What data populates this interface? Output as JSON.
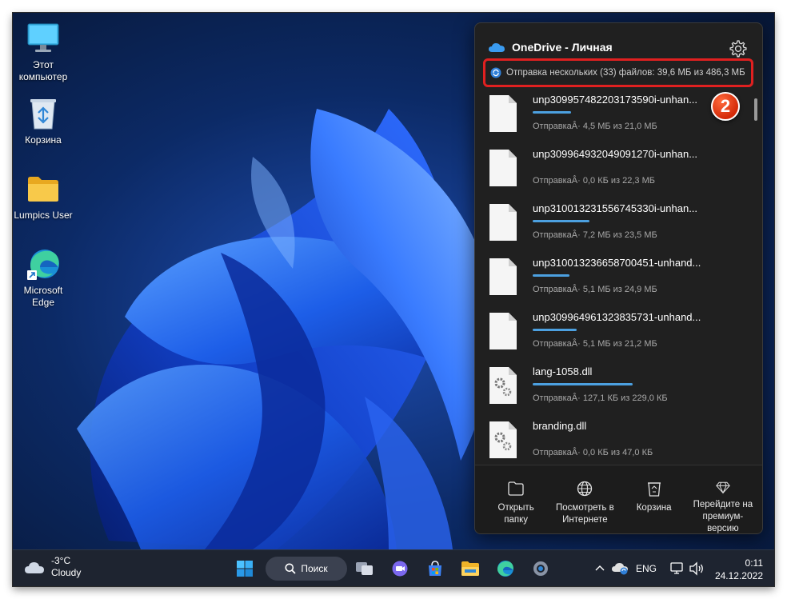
{
  "desktop": {
    "icons": [
      {
        "label_line1": "Этот",
        "label_line2": "компьютер",
        "icon": "monitor-icon"
      },
      {
        "label_line1": "Корзина",
        "label_line2": "",
        "icon": "recycle-bin-icon"
      },
      {
        "label_line1": "Lumpics User",
        "label_line2": "",
        "icon": "folder-icon"
      },
      {
        "label_line1": "Microsoft",
        "label_line2": "Edge",
        "icon": "edge-icon"
      }
    ]
  },
  "onedrive": {
    "title": "OneDrive - Личная",
    "status": "Отправка нескольких (33) файлов: 39,6 МБ из 486,3 МБ",
    "step_badge": "2",
    "accent_color": "#4ca0e0",
    "highlight_color": "#e02020",
    "files": [
      {
        "name": "unp309957482203173590i-unhan...",
        "status": "ОтправкаÂ· 4,5 МБ из 21,0 МБ",
        "progress": 0.21,
        "type": "document"
      },
      {
        "name": "unp309964932049091270i-unhan...",
        "status": "ОтправкаÂ· 0,0 КБ из 22,3 МБ",
        "progress": 0.0,
        "type": "document"
      },
      {
        "name": "unp310013231556745330i-unhan...",
        "status": "ОтправкаÂ· 7,2 МБ из 23,5 МБ",
        "progress": 0.31,
        "type": "document"
      },
      {
        "name": "unp310013236658700451-unhand...",
        "status": "ОтправкаÂ· 5,1 МБ из 24,9 МБ",
        "progress": 0.2,
        "type": "document"
      },
      {
        "name": "unp309964961323835731-unhand...",
        "status": "ОтправкаÂ· 5,1 МБ из 21,2 МБ",
        "progress": 0.24,
        "type": "document"
      },
      {
        "name": "lang-1058.dll",
        "status": "ОтправкаÂ· 127,1 КБ из 229,0 КБ",
        "progress": 0.55,
        "type": "dll"
      },
      {
        "name": "branding.dll",
        "status": "ОтправкаÂ· 0,0 КБ из 47,0 КБ",
        "progress": 0.0,
        "type": "dll"
      }
    ],
    "footer": [
      {
        "label_line1": "Открыть",
        "label_line2": "папку",
        "label_line3": "",
        "icon": "folder-outline-icon"
      },
      {
        "label_line1": "Посмотреть в",
        "label_line2": "Интернете",
        "label_line3": "",
        "icon": "globe-icon"
      },
      {
        "label_line1": "Корзина",
        "label_line2": "",
        "label_line3": "",
        "icon": "recycle-bin-icon"
      },
      {
        "label_line1": "Перейдите на",
        "label_line2": "премиум-",
        "label_line3": "версию",
        "icon": "diamond-icon"
      }
    ]
  },
  "taskbar": {
    "weather_temp": "-3°C",
    "weather_desc": "Cloudy",
    "search_label": "Поиск",
    "language": "ENG",
    "time": "0:11",
    "date": "24.12.2022"
  }
}
